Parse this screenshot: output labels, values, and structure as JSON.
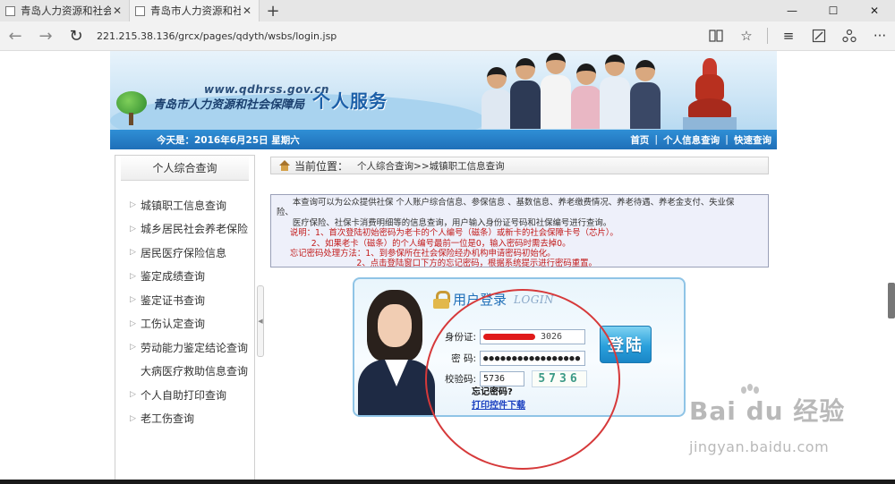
{
  "browser": {
    "tabs": [
      {
        "title": "青岛人力资源和社会保障局",
        "active": false
      },
      {
        "title": "青岛市人力资源和社会保",
        "active": true
      }
    ],
    "new_tab": "+",
    "window_controls": {
      "minimize": "—",
      "maximize": "☐",
      "close": "✕"
    },
    "url": "221.215.38.136/grcx/pages/qdyth/wsbs/login.jsp"
  },
  "header": {
    "site_url": "www.qdhrss.gov.cn",
    "org_name": "青岛市人力资源和社会保障局",
    "service_title": "个人服务",
    "date_text": "今天是：2016年6月25日 星期六",
    "top_links": [
      "首页",
      "个人信息查询",
      "快速查询"
    ]
  },
  "sidebar": {
    "title": "个人综合查询",
    "items": [
      {
        "label": "城镇职工信息查询",
        "arrow": true
      },
      {
        "label": "城乡居民社会养老保险",
        "arrow": true
      },
      {
        "label": "居民医疗保险信息",
        "arrow": true
      },
      {
        "label": "鉴定成绩查询",
        "arrow": true
      },
      {
        "label": "鉴定证书查询",
        "arrow": true
      },
      {
        "label": "工伤认定查询",
        "arrow": true
      },
      {
        "label": "劳动能力鉴定结论查询",
        "arrow": true
      },
      {
        "label": "大病医疗救助信息查询",
        "arrow": false
      },
      {
        "label": "个人自助打印查询",
        "arrow": true
      },
      {
        "label": "老工伤查询",
        "arrow": true
      }
    ]
  },
  "breadcrumb": {
    "label": "当前位置：",
    "path": "个人综合查询>>城镇职工信息查询"
  },
  "notice": {
    "line1": "      本查询可以为公众提供社保 个人账户综合信息、参保信息 、基数信息、养老缴费情况、养老待遇、养老金支付、失业保",
    "line2": "险、",
    "line3": "      医疗保险、社保卡消费明细等的信息查询，用户输入身份证号码和社保编号进行查询。",
    "line4": "     说明：1、首次登陆初始密码为老卡的个人编号（磁条）或新卡的社会保障卡号（芯片）。",
    "line5": "             2、如果老卡（磁条）的个人编号最前一位是0，输入密码时需去掉0。",
    "line6": "     忘记密码处理方法：1、到参保所在社会保险经办机构申请密码初始化。",
    "line7": "                              2、点击登陆窗口下方的忘记密码，根据系统提示进行密码重置。"
  },
  "login": {
    "title_zh": "用户登录",
    "title_en": "LOGIN",
    "id_label": "身份证:",
    "id_value_tail": "3026",
    "password_label": "密   码:",
    "password_value": "●●●●●●●●●●●●●●●●●",
    "captcha_label": "校验码:",
    "captcha_value": "5736",
    "captcha_image_text": "5736",
    "login_button": "登陆",
    "forgot_password": "忘记密码?",
    "download_link": "打印控件下载"
  },
  "watermark": {
    "brand": "Bai du 经验",
    "site": "jingyan.baidu.com"
  },
  "colors": {
    "bluebar": "#1f6fb8",
    "accent_red": "#c21a1a",
    "annotation": "#d6393a",
    "link_blue": "#1a3fc0"
  }
}
